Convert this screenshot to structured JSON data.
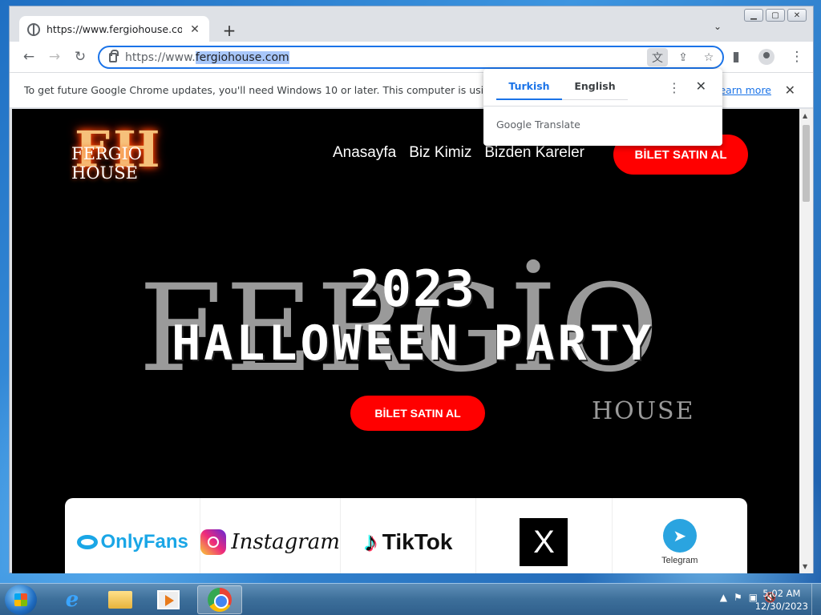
{
  "browser": {
    "tab_title": "https://www.fergiohouse.com",
    "url_prefix": "https://www.",
    "url_host": "fergiohouse.com",
    "infobar_text": "To get future Google Chrome updates, you'll need Windows 10 or later. This computer is using Wind",
    "infobar_link": "earn more"
  },
  "translate_popup": {
    "tab_source": "Turkish",
    "tab_target": "English",
    "brand": "Google Translate"
  },
  "site": {
    "logo_letters": "FH",
    "logo_name": "FERGIO HOUSE",
    "nav": [
      "Anasayfa",
      "Biz Kimiz",
      "Bizden Kareler"
    ],
    "cta_top": "BİLET SATIN AL",
    "bg_word": "FERGİO",
    "bg_sub": "HOUSE",
    "hero_year": "2023",
    "hero_title": "HALLOWEEN PARTY",
    "cta_mid": "BİLET SATIN AL",
    "social": {
      "onlyfans": "OnlyFans",
      "instagram": "Instagram",
      "tiktok": "TikTok",
      "x": "X",
      "telegram": "Telegram"
    }
  },
  "taskbar": {
    "time": "5:02 AM",
    "date": "12/30/2023"
  },
  "colors": {
    "accent": "#1a73e8",
    "cta_red": "#ff0000"
  }
}
